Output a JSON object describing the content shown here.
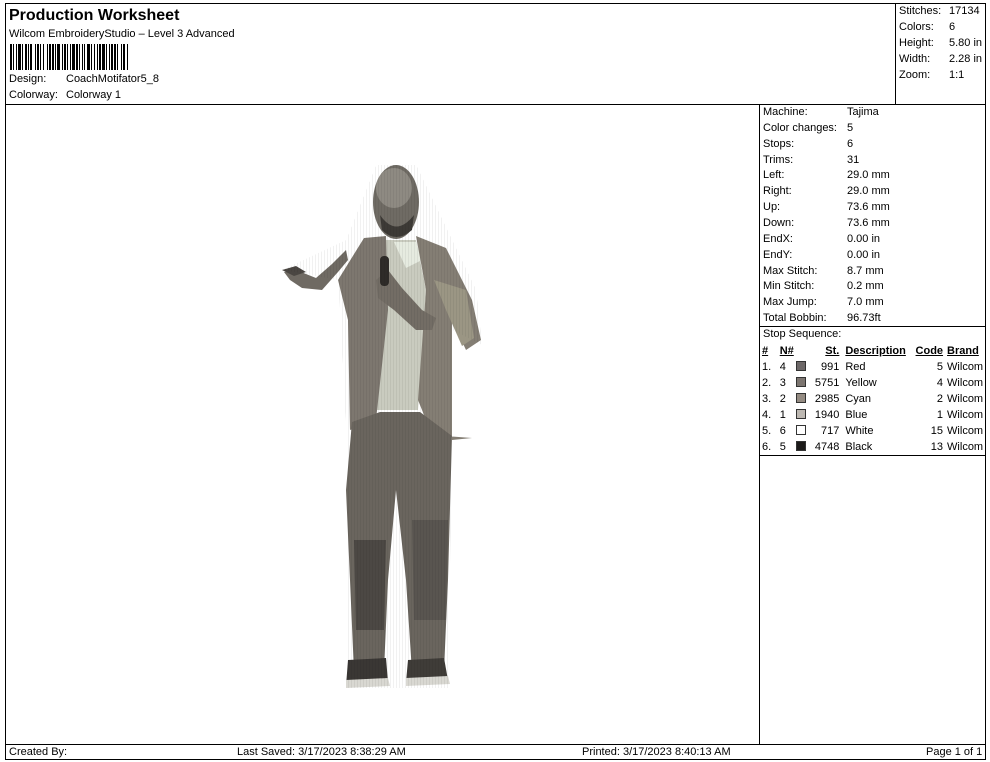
{
  "header": {
    "title": "Production Worksheet",
    "software": "Wilcom EmbroideryStudio – Level 3 Advanced",
    "design_label": "Design:",
    "design_value": "CoachMotifator5_8",
    "colorway_label": "Colorway:",
    "colorway_value": "Colorway 1"
  },
  "summary": {
    "stitches_label": "Stitches:",
    "stitches_value": "17134",
    "colors_label": "Colors:",
    "colors_value": "6",
    "height_label": "Height:",
    "height_value": "5.80 in",
    "width_label": "Width:",
    "width_value": "2.28 in",
    "zoom_label": "Zoom:",
    "zoom_value": "1:1"
  },
  "specs": [
    {
      "label": "Machine:",
      "value": "Tajima"
    },
    {
      "label": "Color changes:",
      "value": "5"
    },
    {
      "label": "Stops:",
      "value": "6"
    },
    {
      "label": "Trims:",
      "value": "31"
    },
    {
      "label": "Left:",
      "value": "29.0 mm"
    },
    {
      "label": "Right:",
      "value": "29.0 mm"
    },
    {
      "label": "Up:",
      "value": "73.6 mm"
    },
    {
      "label": "Down:",
      "value": "73.6 mm"
    },
    {
      "label": "EndX:",
      "value": "0.00 in"
    },
    {
      "label": "EndY:",
      "value": "0.00 in"
    },
    {
      "label": "Max Stitch:",
      "value": "8.7 mm"
    },
    {
      "label": "Min Stitch:",
      "value": "0.2 mm"
    },
    {
      "label": "Max Jump:",
      "value": "7.0 mm"
    },
    {
      "label": "Total Bobbin:",
      "value": "96.73ft"
    }
  ],
  "stop_sequence": {
    "title": "Stop Sequence:",
    "columns": [
      "#",
      "N#",
      "St.",
      "Description",
      "Code",
      "Brand"
    ],
    "rows": [
      {
        "num": "1.",
        "n": "4",
        "color": "#6d6868",
        "st": "991",
        "desc": "Red",
        "code": "5",
        "brand": "Wilcom"
      },
      {
        "num": "2.",
        "n": "3",
        "color": "#7c7570",
        "st": "5751",
        "desc": "Yellow",
        "code": "4",
        "brand": "Wilcom"
      },
      {
        "num": "3.",
        "n": "2",
        "color": "#948b82",
        "st": "2985",
        "desc": "Cyan",
        "code": "2",
        "brand": "Wilcom"
      },
      {
        "num": "4.",
        "n": "1",
        "color": "#bdb8b2",
        "st": "1940",
        "desc": "Blue",
        "code": "1",
        "brand": "Wilcom"
      },
      {
        "num": "5.",
        "n": "6",
        "color": "#ffffff",
        "st": "717",
        "desc": "White",
        "code": "15",
        "brand": "Wilcom"
      },
      {
        "num": "6.",
        "n": "5",
        "color": "#1c1a19",
        "st": "4748",
        "desc": "Black",
        "code": "13",
        "brand": "Wilcom"
      }
    ]
  },
  "footer": {
    "created_by": "Created By:",
    "last_saved": "Last Saved: 3/17/2023 8:38:29 AM",
    "printed": "Printed: 3/17/2023 8:40:13 AM",
    "page": "Page 1 of 1"
  }
}
